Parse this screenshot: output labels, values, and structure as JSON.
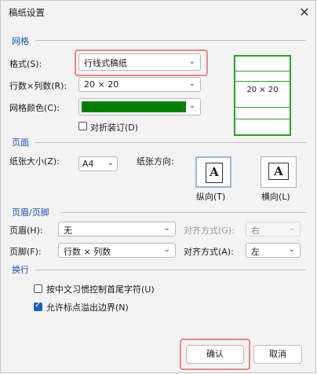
{
  "window": {
    "title": "稿纸设置"
  },
  "grid": {
    "section": "网格",
    "format_label": "格式(S):",
    "format_value": "行线式稿纸",
    "rowcol_label": "行数×列数(R):",
    "rowcol_value": "20 × 20",
    "color_label": "网格颜色(C):",
    "color": "#008000",
    "fold_label": "对折装订(D)",
    "preview_text": "20 × 20"
  },
  "page": {
    "section": "页面",
    "size_label": "纸张大小(Z):",
    "size_value": "A4",
    "orient_label": "纸张方向:",
    "portrait_label": "纵向(T)",
    "landscape_label": "横向(L)",
    "icon_letter": "A"
  },
  "header_footer": {
    "section": "页眉/页脚",
    "header_label": "页眉(H):",
    "header_value": "无",
    "header_align_label": "对齐方式(G):",
    "header_align_value": "右",
    "footer_label": "页脚(F):",
    "footer_value": "行数 × 列数",
    "footer_align_label": "对齐方式(A):",
    "footer_align_value": "左"
  },
  "wrap": {
    "section": "换行",
    "opt1_label": "按中文习惯控制首尾字符(U)",
    "opt1_checked": false,
    "opt2_label": "允许标点溢出边界(N)",
    "opt2_checked": true
  },
  "buttons": {
    "ok": "确认",
    "cancel": "取消"
  }
}
